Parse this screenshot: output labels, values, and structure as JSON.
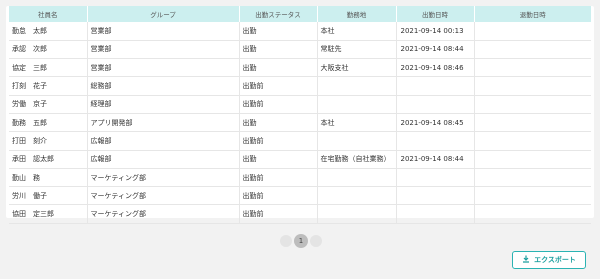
{
  "table": {
    "columns": [
      "社員名",
      "グループ",
      "出勤ステータス",
      "勤務地",
      "出勤日時",
      "退勤日時"
    ],
    "rows": [
      {
        "name": "勤怠　太郎",
        "group": "営業部",
        "status": "出勤",
        "location": "本社",
        "clock_in": "2021-09-14 00:13",
        "clock_out": ""
      },
      {
        "name": "承認　次郎",
        "group": "営業部",
        "status": "出勤",
        "location": "常駐先",
        "clock_in": "2021-09-14 08:44",
        "clock_out": ""
      },
      {
        "name": "協定　三郎",
        "group": "営業部",
        "status": "出勤",
        "location": "大阪支社",
        "clock_in": "2021-09-14 08:46",
        "clock_out": ""
      },
      {
        "name": "打刻　花子",
        "group": "総務部",
        "status": "出勤前",
        "location": "",
        "clock_in": "",
        "clock_out": ""
      },
      {
        "name": "労働　京子",
        "group": "経理部",
        "status": "出勤前",
        "location": "",
        "clock_in": "",
        "clock_out": ""
      },
      {
        "name": "勤務　五郎",
        "group": "アプリ開発部",
        "status": "出勤",
        "location": "本社",
        "clock_in": "2021-09-14 08:45",
        "clock_out": ""
      },
      {
        "name": "打田　刻介",
        "group": "広報部",
        "status": "出勤前",
        "location": "",
        "clock_in": "",
        "clock_out": ""
      },
      {
        "name": "承田　認太郎",
        "group": "広報部",
        "status": "出勤",
        "location": "在宅勤務（自社業務）",
        "clock_in": "2021-09-14 08:44",
        "clock_out": ""
      },
      {
        "name": "勤山　務",
        "group": "マーケティング部",
        "status": "出勤前",
        "location": "",
        "clock_in": "",
        "clock_out": ""
      },
      {
        "name": "労川　働子",
        "group": "マーケティング部",
        "status": "出勤前",
        "location": "",
        "clock_in": "",
        "clock_out": ""
      },
      {
        "name": "協田　定三郎",
        "group": "マーケティング部",
        "status": "出勤前",
        "location": "",
        "clock_in": "",
        "clock_out": ""
      }
    ]
  },
  "pagination": {
    "current_page": "1"
  },
  "export": {
    "label": "エクスポート",
    "icon": "download-icon"
  }
}
